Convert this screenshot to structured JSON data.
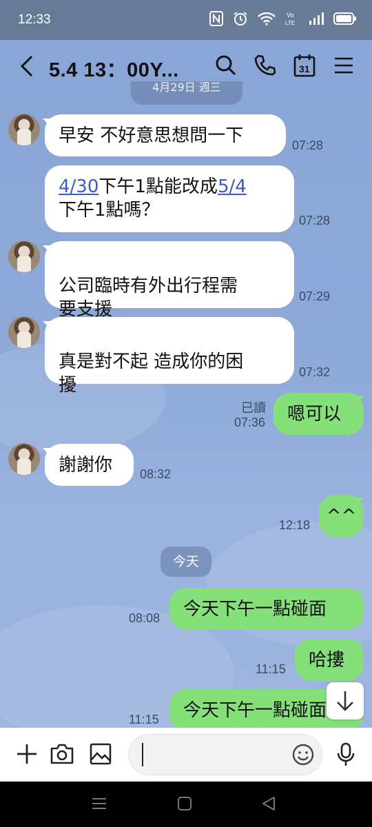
{
  "status_bar": {
    "time": "12:33",
    "icons": [
      "nfc-icon",
      "alarm-icon",
      "wifi-icon",
      "volte-icon",
      "signal-icon",
      "battery-icon"
    ],
    "volte_label": "Vo\nLTE"
  },
  "header": {
    "title": "5.4 13：00Y...",
    "icons": [
      "back-icon",
      "search-icon",
      "phone-icon",
      "calendar-icon",
      "menu-icon"
    ],
    "calendar_day": "31"
  },
  "partial_date_chip": "4月29日 週三",
  "messages": [
    {
      "side": "in",
      "segments": [
        {
          "text": "早安 不好意思想問一下",
          "link": false
        }
      ],
      "time": "07:28",
      "avatar": true
    },
    {
      "side": "in",
      "segments": [
        {
          "text": "4/30",
          "link": true
        },
        {
          "text": "下午1點能改成",
          "link": false
        },
        {
          "text": "5/4",
          "link": true
        },
        {
          "text": "\n下午1點嗎？",
          "link": false
        }
      ],
      "time": "07:28",
      "avatar": false
    },
    {
      "side": "in",
      "segments": [
        {
          "text": "公司臨時有外出行程需\n要支援",
          "link": false
        }
      ],
      "time": "07:29",
      "avatar": true
    },
    {
      "side": "in",
      "segments": [
        {
          "text": "真是對不起 造成你的困\n擾",
          "link": false
        }
      ],
      "time": "07:32",
      "avatar": true
    },
    {
      "side": "out",
      "text": "嗯可以",
      "read_label": "已讀",
      "time": "07:36"
    },
    {
      "side": "in",
      "segments": [
        {
          "text": "謝謝你",
          "link": false
        }
      ],
      "time": "08:32",
      "avatar": true
    },
    {
      "side": "out",
      "text": "^^",
      "time": "12:18"
    },
    {
      "side": "out",
      "text": "今天下午一點碰面",
      "time": "08:08"
    },
    {
      "side": "out",
      "text": "哈摟",
      "time": "11:15"
    },
    {
      "side": "out",
      "text": "今天下午一點碰面",
      "time": "11:15"
    }
  ],
  "date_chip_today": "今天",
  "input": {
    "placeholder": "",
    "icons": [
      "plus-icon",
      "camera-icon",
      "image-icon",
      "emoji-icon",
      "mic-icon"
    ]
  },
  "nav": [
    "recents-icon",
    "home-icon",
    "back-nav-icon"
  ],
  "colors": {
    "status_bar": "#677a96",
    "chat_bg": "#8aa6d6",
    "outgoing_bubble": "#86e07a",
    "incoming_bubble": "#ffffff",
    "link": "#3a5cc9"
  }
}
